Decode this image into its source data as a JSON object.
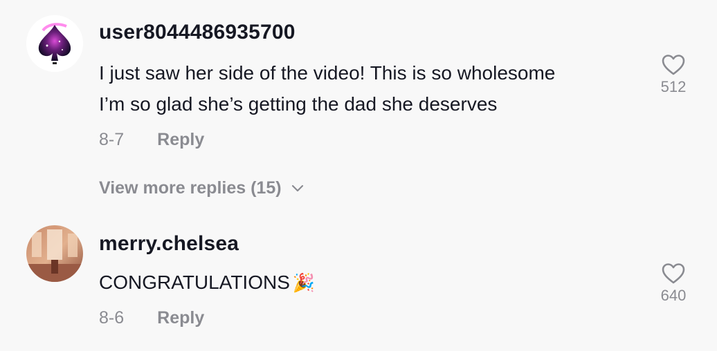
{
  "comments": [
    {
      "username": "user8044486935700",
      "text_line1": "I just saw her side of the video! This is so wholesome",
      "text_line2": "I’m so glad she’s getting the dad she deserves",
      "date": "8-7",
      "reply_label": "Reply",
      "likes": "512",
      "avatar_icon": "spade-icon"
    },
    {
      "username": "merry.chelsea",
      "text": "CONGRATULATIONS",
      "emoji": "🎉",
      "date": "8-6",
      "reply_label": "Reply",
      "likes": "640",
      "avatar_icon": "palace-interior-photo"
    }
  ],
  "view_more_replies": "View more replies (15)",
  "colors": {
    "primary_text": "#161823",
    "secondary_text": "#8a8b91",
    "background": "#f8f8f8"
  }
}
